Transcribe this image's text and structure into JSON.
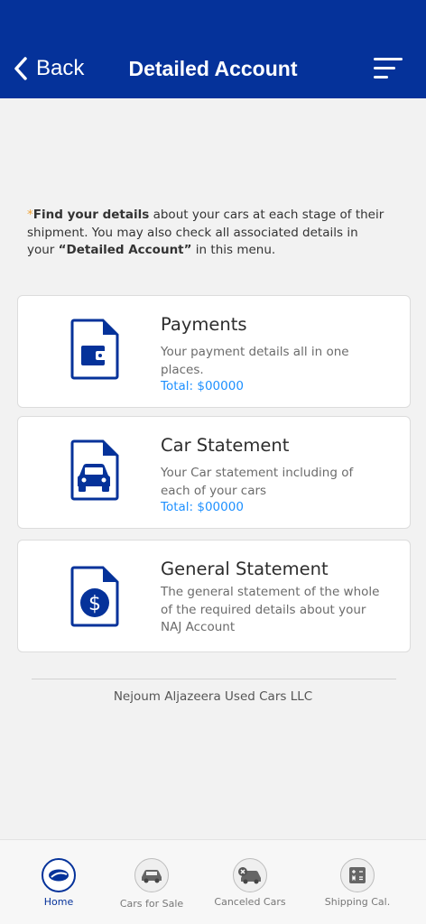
{
  "header": {
    "back_label": "Back",
    "title": "Detailed Account",
    "menu_icon": "sort-menu-icon"
  },
  "intro": {
    "star": "*",
    "bold1": "Find your details",
    "text1": " about your cars at each stage of their shipment. You may also check all associated details in your ",
    "bold2": "“Detailed Account”",
    "text2": " in this menu."
  },
  "cards": [
    {
      "icon": "wallet-document-icon",
      "title": "Payments",
      "description": "Your payment details all in one places.",
      "total": "Total: $00000"
    },
    {
      "icon": "car-document-icon",
      "title": "Car Statement",
      "description": "Your Car statement including of each of your cars",
      "total": "Total: $00000"
    },
    {
      "icon": "dollar-document-icon",
      "title": "General Statement",
      "description": "The general statement of the whole of the required details about your NAJ Account"
    }
  ],
  "footer": {
    "company": "Nejoum Aljazeera Used Cars LLC"
  },
  "tabbar": {
    "tabs": [
      {
        "label": "Home",
        "icon": "home-logo-icon",
        "active": true
      },
      {
        "label": "Cars for Sale",
        "icon": "car-sale-icon",
        "active": false
      },
      {
        "label": "Canceled Cars",
        "icon": "canceled-car-icon",
        "active": false
      },
      {
        "label": "Shipping Cal.",
        "icon": "calculator-icon",
        "active": false
      }
    ]
  },
  "colors": {
    "brand": "#05329a",
    "accent_total": "#1e90ff",
    "star": "#f0a437"
  }
}
